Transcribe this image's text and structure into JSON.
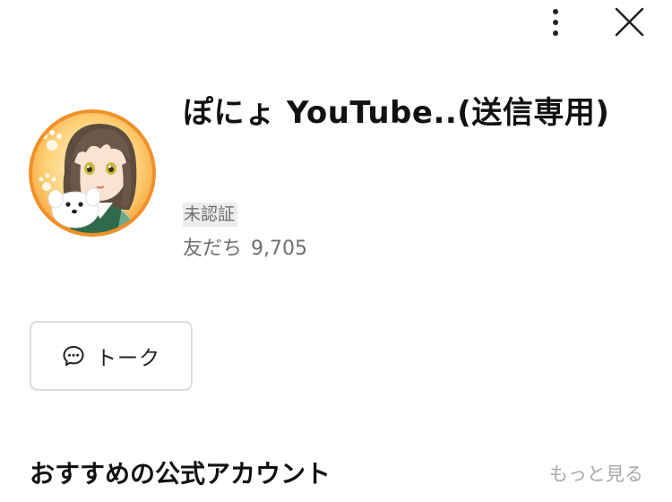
{
  "header": {
    "menu_icon": "more-vertical-icon",
    "close_icon": "close-icon"
  },
  "profile": {
    "avatar_icon": "avatar",
    "name": "ぽにょ YouTube..(送信専用)",
    "badge": "未認証",
    "friends_label": "友だち",
    "friends_count": "9,705",
    "avatar_ring_color": "#f0902a"
  },
  "actions": {
    "talk_label": "トーク",
    "talk_icon": "chat-bubble-icon"
  },
  "recommended": {
    "title": "おすすめの公式アカウント",
    "more_label": "もっと見る"
  }
}
